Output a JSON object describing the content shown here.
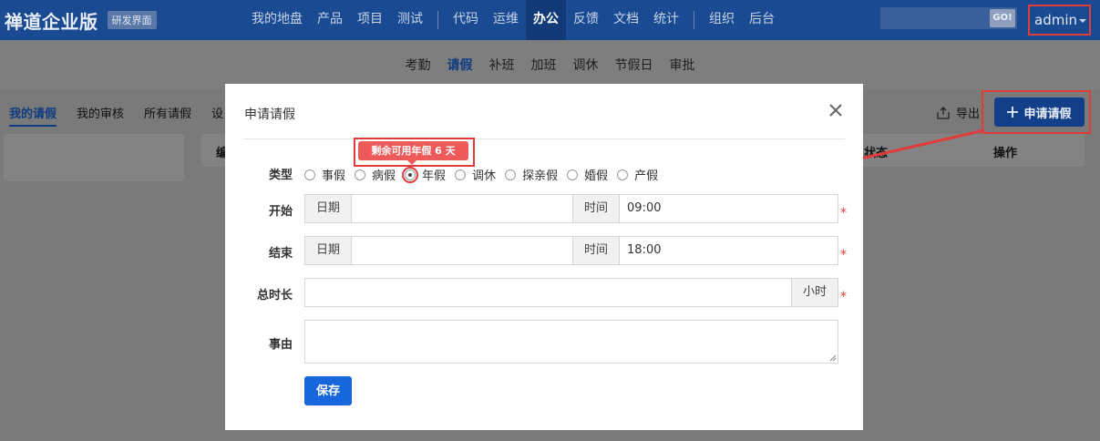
{
  "header": {
    "brand": "禅道企业版",
    "brand_tag": "研发界面",
    "nav_group1": [
      "我的地盘",
      "产品",
      "项目",
      "测试"
    ],
    "nav_group2": [
      "代码",
      "运维",
      "办公",
      "反馈",
      "文档",
      "统计"
    ],
    "nav_group3": [
      "组织",
      "后台"
    ],
    "active_nav": "办公",
    "search": {
      "value": "",
      "go_label": "GO!"
    },
    "user": "admin"
  },
  "subnav": {
    "items": [
      "考勤",
      "请假",
      "补班",
      "加班",
      "调休",
      "节假日",
      "审批"
    ],
    "active": "请假"
  },
  "page": {
    "tabs": [
      "我的请假",
      "我的审核",
      "所有请假",
      "设"
    ],
    "active_tab": "我的请假",
    "export_label": "导出",
    "apply_label": "申请请假",
    "table_header_partial": [
      "编",
      "状态",
      "操作"
    ]
  },
  "modal": {
    "title": "申请请假",
    "tooltip": "剩余可用年假 6 天",
    "type_label": "类型",
    "types": [
      "事假",
      "病假",
      "年假",
      "调休",
      "探亲假",
      "婚假",
      "产假"
    ],
    "selected_type": "年假",
    "start": {
      "label": "开始",
      "date_addon": "日期",
      "date_value": "",
      "time_addon": "时间",
      "time_value": "09:00"
    },
    "end": {
      "label": "结束",
      "date_addon": "日期",
      "date_value": "",
      "time_addon": "时间",
      "time_value": "18:00"
    },
    "duration": {
      "label": "总时长",
      "value": "",
      "unit": "小时"
    },
    "reason": {
      "label": "事由",
      "value": ""
    },
    "required_mark": "*",
    "save_label": "保存"
  },
  "colors": {
    "header_bg": "#1a4a92",
    "highlight": "#e23b3b",
    "primary": "#1766db",
    "tooltip_bg": "#ee5a5a"
  }
}
